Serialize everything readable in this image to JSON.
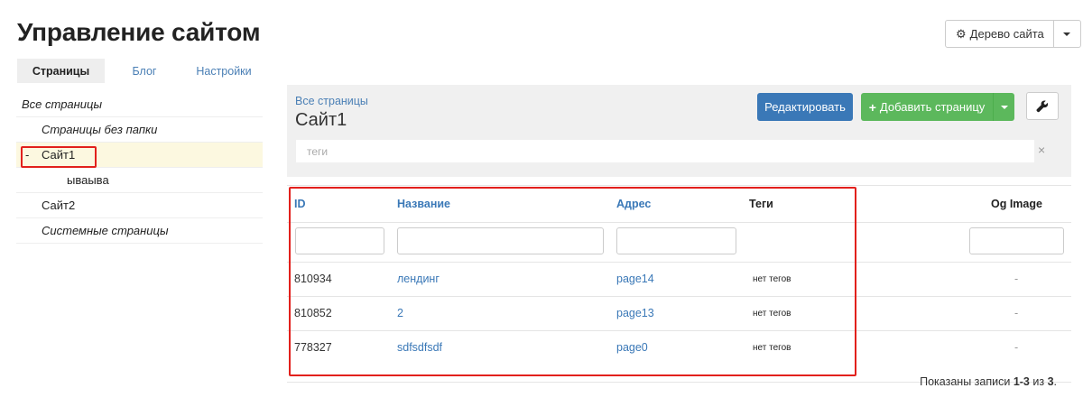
{
  "header": {
    "title": "Управление сайтом",
    "tree_button_label": "Дерево сайта"
  },
  "tabs": [
    {
      "label": "Страницы",
      "active": true
    },
    {
      "label": "Блог",
      "active": false
    },
    {
      "label": "Настройки",
      "active": false
    }
  ],
  "sidebar": {
    "items": [
      {
        "label": "Все страницы",
        "italic": true,
        "level": 0
      },
      {
        "label": "Страницы без папки",
        "italic": true,
        "level": 1
      },
      {
        "label": "Сайт1",
        "italic": false,
        "level": 1,
        "selected": true,
        "prefix": "-"
      },
      {
        "label": "ываыва",
        "italic": false,
        "level": 2
      },
      {
        "label": "Сайт2",
        "italic": false,
        "level": 1
      },
      {
        "label": "Системные страницы",
        "italic": true,
        "level": 1
      }
    ]
  },
  "panel": {
    "breadcrumb": "Все страницы",
    "title": "Сайт1",
    "edit_label": "Редактировать",
    "add_label": "Добавить страницу",
    "tags_placeholder": "теги",
    "tags_clear": "×"
  },
  "table": {
    "columns": {
      "id": "ID",
      "name": "Название",
      "address": "Адрес",
      "tags": "Теги",
      "og": "Og Image"
    },
    "rows": [
      {
        "id": "810934",
        "name": "лендинг",
        "address": "page14",
        "tags": "нет тегов",
        "og": "-"
      },
      {
        "id": "810852",
        "name": "2",
        "address": "page13",
        "tags": "нет тегов",
        "og": "-"
      },
      {
        "id": "778327",
        "name": "sdfsdfsdf",
        "address": "page0",
        "tags": "нет тегов",
        "og": "-"
      }
    ]
  },
  "footer": {
    "prefix": "Показаны записи ",
    "range": "1-3",
    "middle": " из ",
    "total": "3",
    "suffix": "."
  },
  "colors": {
    "accent": "#3a78b7",
    "success": "#5cb85c",
    "highlight": "#e2201c"
  }
}
